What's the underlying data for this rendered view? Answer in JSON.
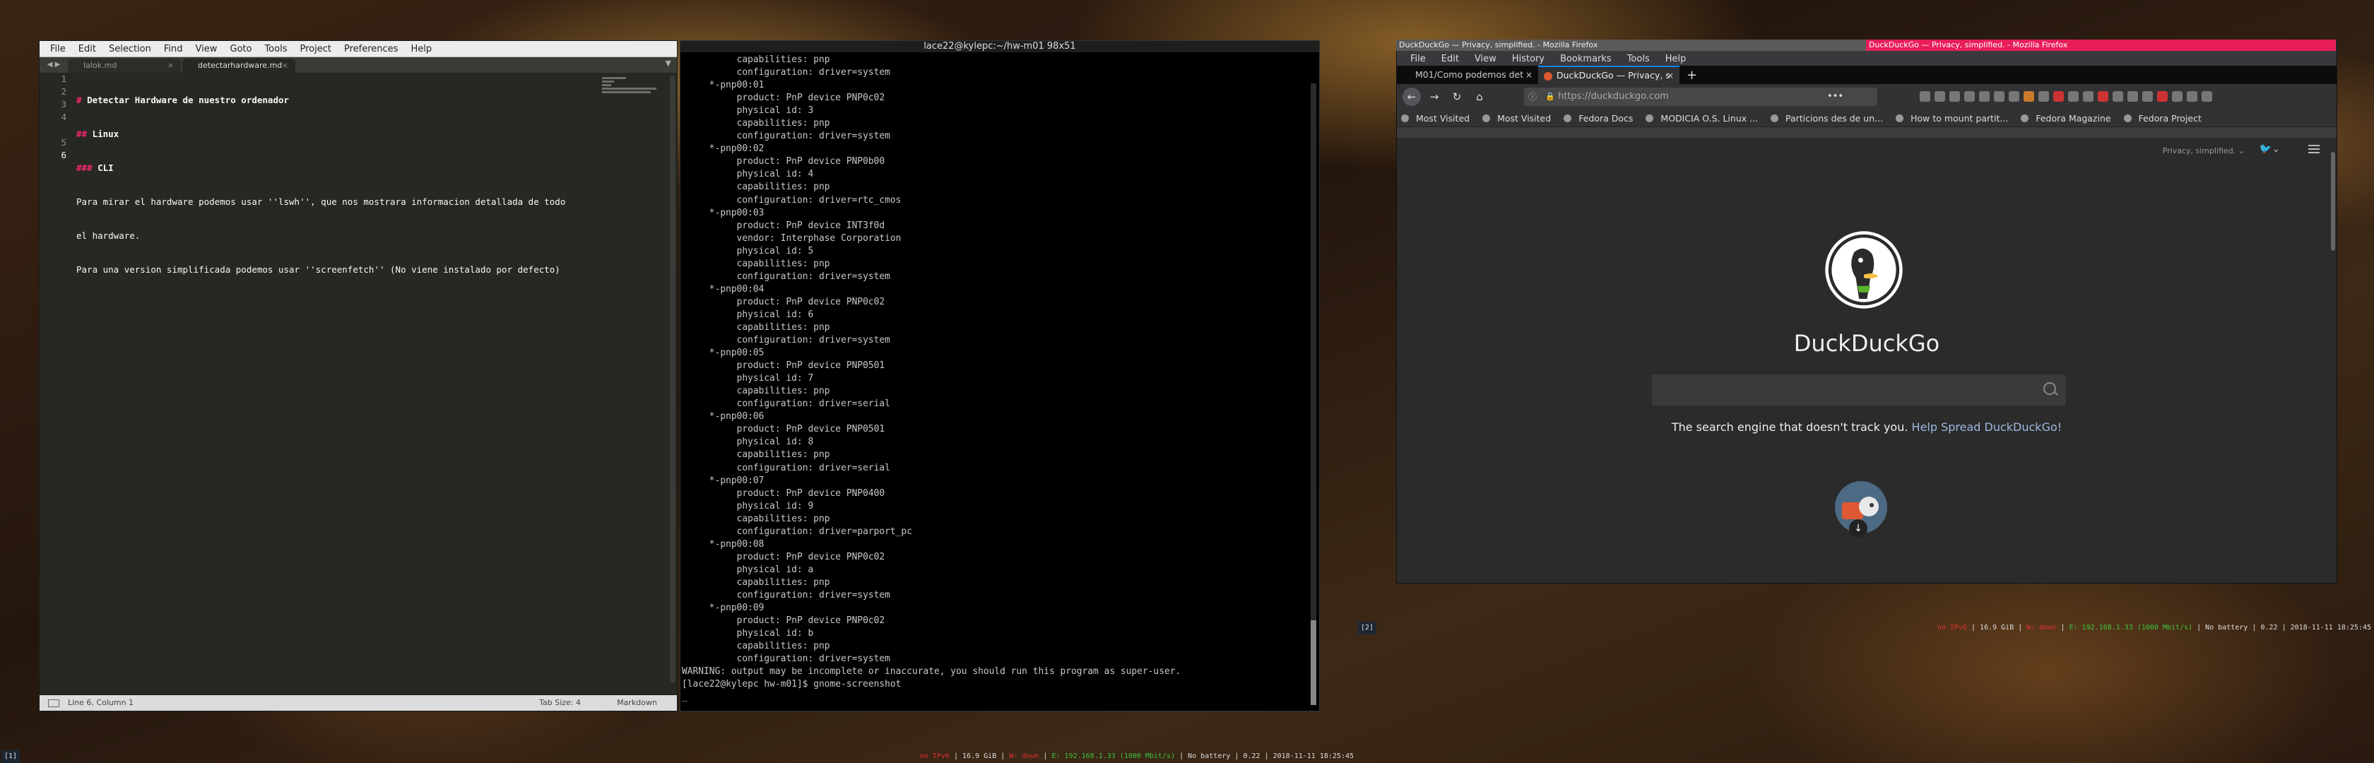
{
  "editor": {
    "menu": [
      "File",
      "Edit",
      "Selection",
      "Find",
      "View",
      "Goto",
      "Tools",
      "Project",
      "Preferences",
      "Help"
    ],
    "tabs": [
      {
        "label": "Ialok.md"
      },
      {
        "label": "detectarhardware.md"
      }
    ],
    "line_numbers": [
      "1",
      "2",
      "3",
      "4",
      "",
      "5",
      "6"
    ],
    "lines": [
      {
        "hash": "# ",
        "text": "Detectar Hardware de nuestro ordenador"
      },
      {
        "hash": "## ",
        "text": "Linux"
      },
      {
        "hash": "### ",
        "text": "CLI"
      },
      {
        "hash": "",
        "text": "Para mirar el hardware podemos usar ''lswh'', que nos mostrara informacion detallada de todo"
      },
      {
        "hash": "",
        "text": "el hardware."
      },
      {
        "hash": "",
        "text": "Para una version simplificada podemos usar ''screenfetch'' (No viene instalado por defecto)"
      },
      {
        "hash": "",
        "text": ""
      }
    ],
    "status": {
      "position": "Line 6, Column 1",
      "tab_size": "Tab Size: 4",
      "syntax": "Markdown"
    }
  },
  "terminal": {
    "title": "lace22@kylepc:~/hw-m01 98x51",
    "lines": [
      "          capabilities: pnp",
      "          configuration: driver=system",
      "     *-pnp00:01",
      "          product: PnP device PNP0c02",
      "          physical id: 3",
      "          capabilities: pnp",
      "          configuration: driver=system",
      "     *-pnp00:02",
      "          product: PnP device PNP0b00",
      "          physical id: 4",
      "          capabilities: pnp",
      "          configuration: driver=rtc_cmos",
      "     *-pnp00:03",
      "          product: PnP device INT3f0d",
      "          vendor: Interphase Corporation",
      "          physical id: 5",
      "          capabilities: pnp",
      "          configuration: driver=system",
      "     *-pnp00:04",
      "          product: PnP device PNP0c02",
      "          physical id: 6",
      "          capabilities: pnp",
      "          configuration: driver=system",
      "     *-pnp00:05",
      "          product: PnP device PNP0501",
      "          physical id: 7",
      "          capabilities: pnp",
      "          configuration: driver=serial",
      "     *-pnp00:06",
      "          product: PnP device PNP0501",
      "          physical id: 8",
      "          capabilities: pnp",
      "          configuration: driver=serial",
      "     *-pnp00:07",
      "          product: PnP device PNP0400",
      "          physical id: 9",
      "          capabilities: pnp",
      "          configuration: driver=parport_pc",
      "     *-pnp00:08",
      "          product: PnP device PNP0c02",
      "          physical id: a",
      "          capabilities: pnp",
      "          configuration: driver=system",
      "     *-pnp00:09",
      "          product: PnP device PNP0c02",
      "          physical id: b",
      "          capabilities: pnp",
      "          configuration: driver=system",
      "WARNING: output may be incomplete or inaccurate, you should run this program as super-user.",
      "[lace22@kylepc hw-m01]$ gnome-screenshot",
      "_"
    ]
  },
  "firefox": {
    "wm_titles": [
      "DuckDuckGo — Privacy, simplified. - Mozilla Firefox",
      "DuckDuckGo — Privacy, simplified. - Mozilla Firefox"
    ],
    "menu": [
      "File",
      "Edit",
      "View",
      "History",
      "Bookmarks",
      "Tools",
      "Help"
    ],
    "tabs": [
      {
        "label": "M01/Como podemos det"
      },
      {
        "label": "DuckDuckGo — Privacy, s"
      }
    ],
    "url": "https://duckduckgo.com",
    "bookmarks": [
      "Most Visited",
      "Most Visited",
      "Fedora Docs",
      "MODICIA O.S. Linux ...",
      "Particions des de un...",
      "How to mount partit...",
      "Fedora Magazine",
      "Fedora Project"
    ],
    "page": {
      "privacy_menu": "Privacy, simplified. ⌄",
      "brand": "DuckDuckGo",
      "tagline": "The search engine that doesn't track you.",
      "tagline_link": "Help Spread DuckDuckGo!"
    }
  },
  "statusbars": {
    "left": {
      "workspace": "[1]",
      "no_ipv6": "no IPv6",
      "disk": "16.9 GiB",
      "wifi": "W: down",
      "eth": "E: 192.168.1.33 (1000 Mbit/s)",
      "battery": "No battery",
      "load": "0.22",
      "time": "2018-11-11 18:25:45"
    },
    "right": {
      "workspace": "[2]",
      "no_ipv6": "no IPv6",
      "disk": "16.9 GiB",
      "wifi": "W: down",
      "eth": "E: 192.168.1.33 (1000 Mbit/s)",
      "battery": "No battery",
      "load": "0.22",
      "time": "2018-11-11 18:25:45"
    }
  }
}
